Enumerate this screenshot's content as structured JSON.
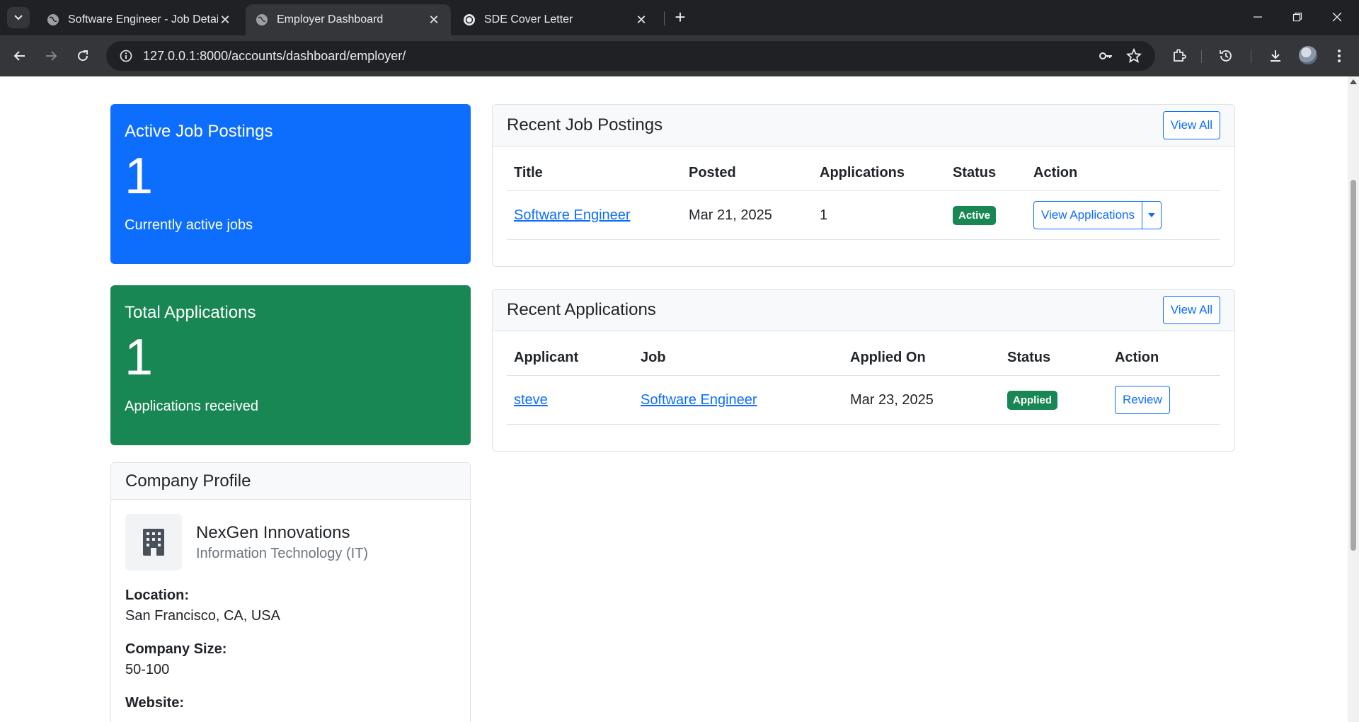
{
  "browser": {
    "tabs": [
      {
        "title": "Software Engineer - Job Details",
        "active": false
      },
      {
        "title": "Employer Dashboard",
        "active": true
      },
      {
        "title": "SDE Cover Letter",
        "active": false
      }
    ],
    "url": "127.0.0.1:8000/accounts/dashboard/employer/"
  },
  "stats": {
    "active_jobs": {
      "label": "Active Job Postings",
      "value": "1",
      "sub": "Currently active jobs",
      "color": "#0d6efd"
    },
    "applications": {
      "label": "Total Applications",
      "value": "1",
      "sub": "Applications received",
      "color": "#198754"
    }
  },
  "recent_jobs": {
    "title": "Recent Job Postings",
    "view_all": "View All",
    "columns": [
      "Title",
      "Posted",
      "Applications",
      "Status",
      "Action"
    ],
    "rows": [
      {
        "title": "Software Engineer",
        "posted": "Mar 21, 2025",
        "applications": "1",
        "status": "Active",
        "action": "View Applications"
      }
    ]
  },
  "recent_applications": {
    "title": "Recent Applications",
    "view_all": "View All",
    "columns": [
      "Applicant",
      "Job",
      "Applied On",
      "Status",
      "Action"
    ],
    "rows": [
      {
        "applicant": "steve",
        "job": "Software Engineer",
        "applied_on": "Mar 23, 2025",
        "status": "Applied",
        "action": "Review"
      }
    ]
  },
  "company": {
    "header": "Company Profile",
    "name": "NexGen Innovations",
    "industry": "Information Technology (IT)",
    "location_label": "Location:",
    "location": "San Francisco, CA, USA",
    "size_label": "Company Size:",
    "size": "50-100",
    "website_label": "Website:"
  }
}
